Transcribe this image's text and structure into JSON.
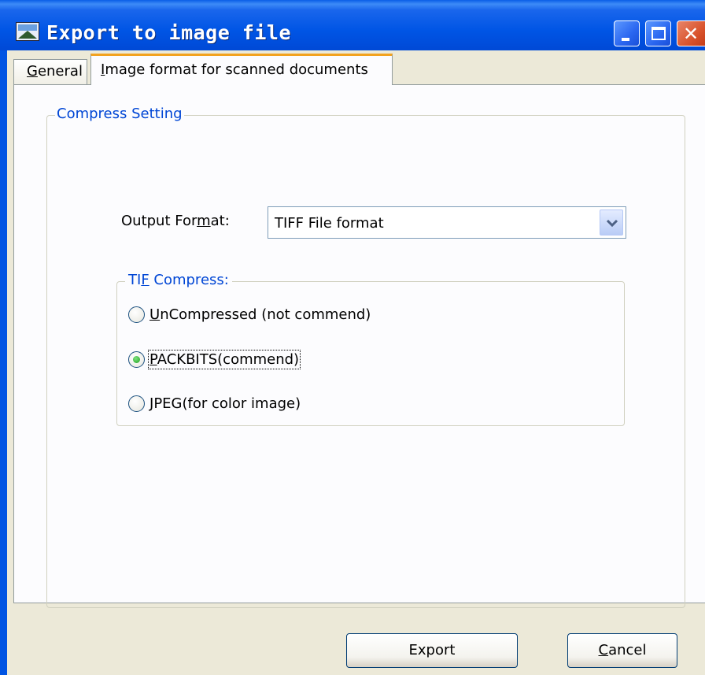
{
  "window": {
    "title": "Export to image file"
  },
  "tabs": [
    {
      "label_pre": "",
      "label_ul": "G",
      "label_post": "eneral",
      "active": false
    },
    {
      "label_pre": "",
      "label_ul": "I",
      "label_post": "mage format for scanned documents",
      "active": true
    }
  ],
  "compress_group": {
    "legend": "Compress Setting"
  },
  "output_format": {
    "label_pre": "Output For",
    "label_ul": "m",
    "label_post": "at:",
    "selected": "TIFF File format"
  },
  "tif_group": {
    "legend_pre": "TI",
    "legend_ul": "F",
    "legend_post": " Compress:",
    "options": [
      {
        "ul": "U",
        "rest": "nCompressed (not commend)",
        "checked": false
      },
      {
        "ul": "P",
        "rest": "ACKBITS(commend)",
        "checked": true
      },
      {
        "ul": "J",
        "rest": "PEG(for color image)",
        "checked": false
      }
    ]
  },
  "buttons": {
    "export_label": "Export",
    "cancel_ul": "C",
    "cancel_rest": "ancel"
  },
  "icons": {
    "window": "image-file-icon",
    "minimize": "minimize-icon",
    "maximize": "maximize-icon",
    "close": "close-icon",
    "dropdown": "chevron-down-icon"
  },
  "colors": {
    "titlebar": "#0055e5",
    "accent_tab": "#f2a21f",
    "group_legend": "#0046d5",
    "radio_checked": "#21a121",
    "dialog_bg": "#ece9d8"
  }
}
